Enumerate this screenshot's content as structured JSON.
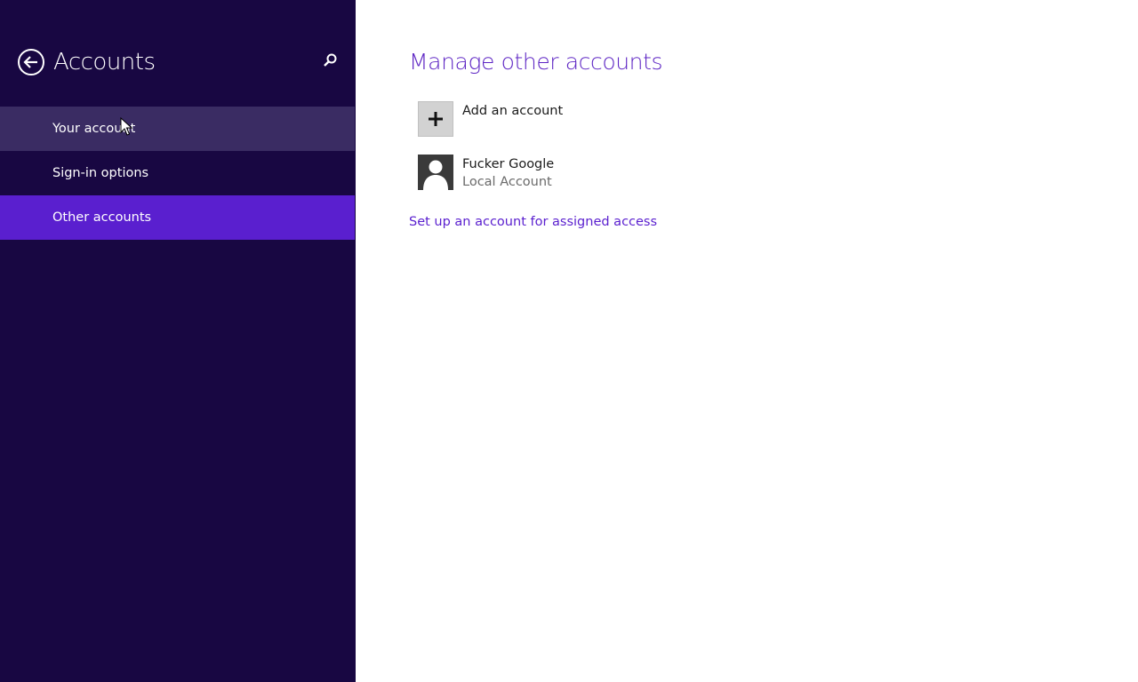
{
  "colors": {
    "sidebar_bg": "#180742",
    "nav_selected": "#5a1fcf",
    "nav_hover": "#3a2c63",
    "accent": "#5e26c4"
  },
  "sidebar": {
    "back_icon": "back-arrow-circle-icon",
    "title": "Accounts",
    "search_icon": "search-icon",
    "items": [
      {
        "label": "Your account",
        "state": "hover"
      },
      {
        "label": "Sign-in options",
        "state": "normal"
      },
      {
        "label": "Other accounts",
        "state": "selected"
      }
    ]
  },
  "main": {
    "title": "Manage other accounts",
    "add_account": {
      "icon": "plus-icon",
      "label": "Add an account"
    },
    "accounts": [
      {
        "icon": "user-avatar-icon",
        "name": "Fucker Google",
        "type": "Local Account"
      }
    ],
    "assigned_access_link": "Set up an account for assigned access"
  }
}
